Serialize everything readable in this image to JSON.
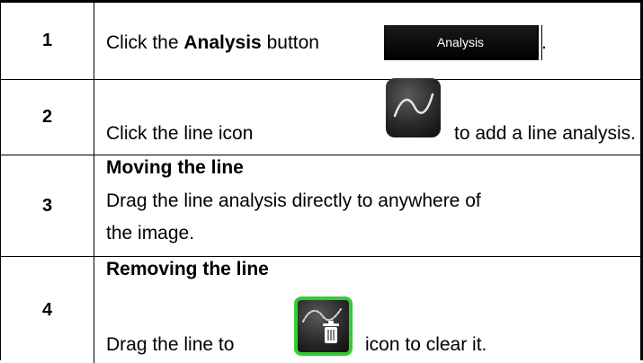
{
  "steps": [
    {
      "number": "1",
      "text_before": "Click the ",
      "text_bold": "Analysis",
      "text_after": " button",
      "button_label": "Analysis",
      "text_end": "."
    },
    {
      "number": "2",
      "text_before": "Click the line icon",
      "text_after": "to add a line analysis.",
      "icon": "line-analysis-icon"
    },
    {
      "number": "3",
      "heading": "Moving the line",
      "line1": "Drag the line analysis directly to anywhere of",
      "line2": "the image."
    },
    {
      "number": "4",
      "heading": "Removing the line",
      "text_before": "Drag the line to",
      "text_after": "icon to clear it.",
      "icon": "trash-icon"
    }
  ],
  "colors": {
    "button_bg": "#000000",
    "button_text": "#ffffff",
    "icon_border_highlight": "#33cc33"
  }
}
